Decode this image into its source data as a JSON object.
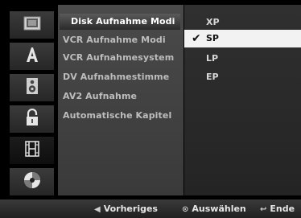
{
  "menu": {
    "items": [
      "Disk Aufnahme Modi",
      "VCR Aufnahme Modi",
      "VCR Aufnahmesystem",
      "DV Aufnahmestimme",
      "AV2 Aufnahme",
      "Automatische Kapitel"
    ],
    "selected_index": 0
  },
  "options": {
    "items": [
      "XP",
      "SP",
      "LP",
      "EP"
    ],
    "checked_index": 1
  },
  "sidebar": {
    "icons": [
      "disc-tray-icon",
      "letter-a-icon",
      "speaker-icon",
      "padlock-icon",
      "film-icon",
      "disc-icon"
    ],
    "active_index": 4
  },
  "footer": {
    "prev_label": "Vorheriges",
    "select_label": "Auswählen",
    "end_label": "Ende"
  },
  "colors": {
    "menu_bg": "#444444",
    "options_bg": "#2a2a2a",
    "checked_bg": "#f2f2f2",
    "text": "#bdbdbd"
  }
}
